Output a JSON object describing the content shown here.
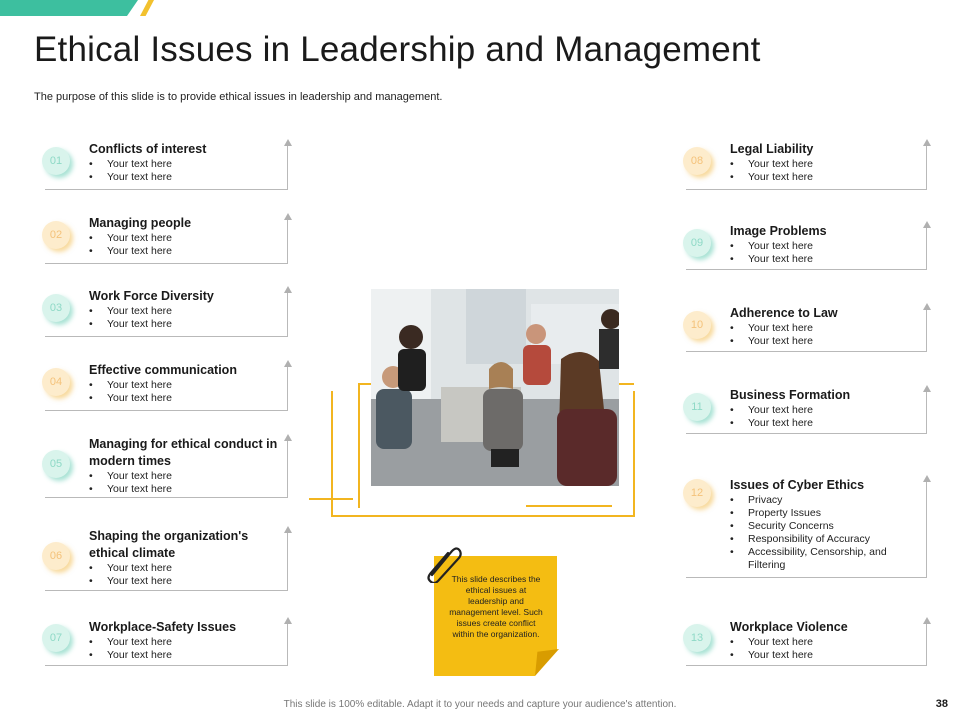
{
  "title": "Ethical Issues in Leadership and Management",
  "subtitle": "The purpose of this slide is to provide ethical issues in leadership and management.",
  "left_items": [
    {
      "num": "01",
      "heading": "Conflicts of interest",
      "bullets": [
        "Your text here",
        "Your text here"
      ],
      "color": "teal"
    },
    {
      "num": "02",
      "heading": "Managing people",
      "bullets": [
        "Your text here",
        "Your text here"
      ],
      "color": "gold"
    },
    {
      "num": "03",
      "heading": "Work Force Diversity",
      "bullets": [
        "Your text here",
        "Your text here"
      ],
      "color": "teal"
    },
    {
      "num": "04",
      "heading": "Effective communication",
      "bullets": [
        "Your text here",
        "Your text here"
      ],
      "color": "gold"
    },
    {
      "num": "05",
      "heading": "Managing for ethical conduct in modern times",
      "bullets": [
        "Your text here",
        "Your text here"
      ],
      "color": "teal"
    },
    {
      "num": "06",
      "heading": "Shaping the organization's ethical climate",
      "bullets": [
        "Your text here",
        "Your text here"
      ],
      "color": "gold"
    },
    {
      "num": "07",
      "heading": "Workplace-Safety Issues",
      "bullets": [
        "Your text here",
        "Your text here"
      ],
      "color": "teal"
    }
  ],
  "right_items": [
    {
      "num": "08",
      "heading": "Legal Liability",
      "bullets": [
        "Your text here",
        "Your text here"
      ],
      "color": "gold"
    },
    {
      "num": "09",
      "heading": "Image Problems",
      "bullets": [
        "Your text here",
        "Your text here"
      ],
      "color": "teal"
    },
    {
      "num": "10",
      "heading": "Adherence to Law",
      "bullets": [
        "Your text here",
        "Your text here"
      ],
      "color": "gold"
    },
    {
      "num": "11",
      "heading": "Business Formation",
      "bullets": [
        "Your text here",
        "Your text here"
      ],
      "color": "teal"
    },
    {
      "num": "12",
      "heading": "Issues of Cyber Ethics",
      "bullets": [
        "Privacy",
        "Property Issues",
        "Security Concerns",
        "Responsibility of Accuracy",
        "Accessibility, Censorship, and Filtering"
      ],
      "color": "gold"
    },
    {
      "num": "13",
      "heading": "Workplace Violence",
      "bullets": [
        "Your text here",
        "Your text here"
      ],
      "color": "teal"
    }
  ],
  "note": "This slide describes the ethical issues at leadership and management level. Such issues create conflict within the organization.",
  "footer": "This slide is 100% editable. Adapt it to your needs and capture your audience's attention.",
  "page_number": "38",
  "colors": {
    "teal": "#3dbf9f",
    "gold": "#f2b520",
    "note": "#f4bd12"
  }
}
